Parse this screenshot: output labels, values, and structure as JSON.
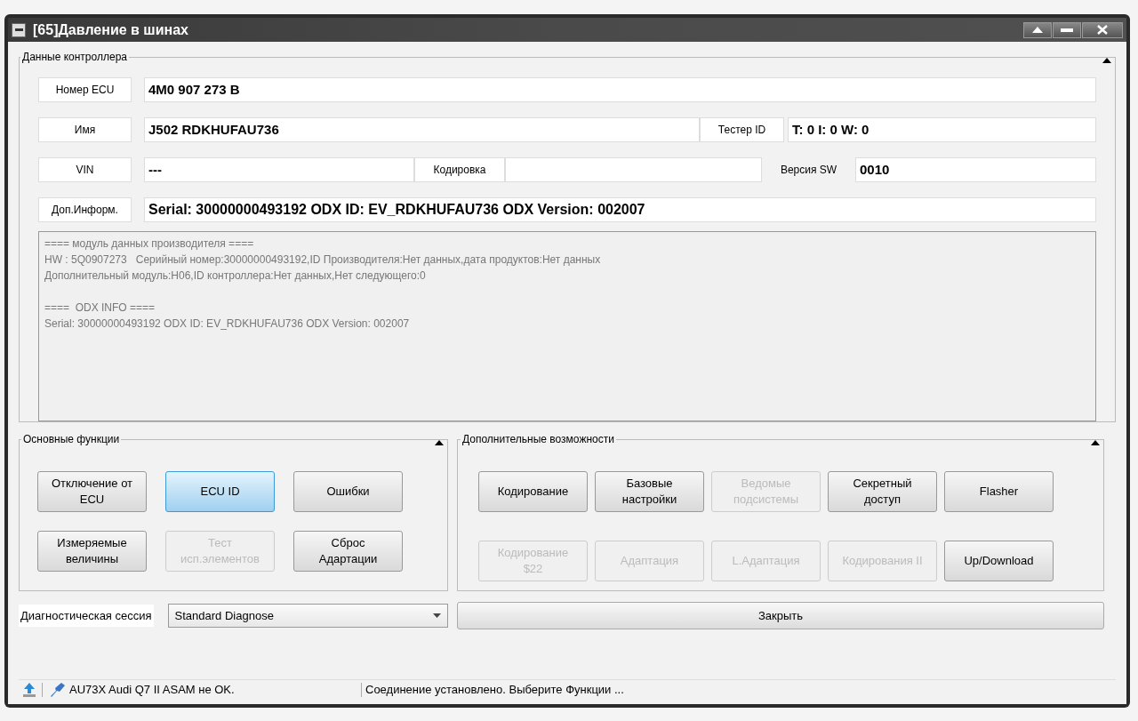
{
  "window": {
    "title": "[65]Давление в шинах"
  },
  "controller_data": {
    "title": "Данные контроллера",
    "ecu_number": {
      "label": "Номер ECU",
      "value": "4M0 907 273 B"
    },
    "name": {
      "label": "Имя",
      "value": "J502  RDKHUFAU736"
    },
    "tester_id": {
      "label": "Тестер ID",
      "value": "T: 0 I: 0 W: 0"
    },
    "vin": {
      "label": "VIN",
      "value": "---"
    },
    "coding": {
      "label": "Кодировка"
    },
    "sw_version": {
      "label": "Версия SW",
      "value": "0010"
    },
    "extra_info": {
      "label": "Доп.Информ.",
      "value": "Serial: 30000000493192 ODX ID: EV_RDKHUFAU736 ODX Version: 002007"
    },
    "details": [
      [
        "==== модуль данных производителя ====",
        "HW : 5Q0907273   Серийный номер:30000000493192,ID Производителя:Нет данных,дата продуктов:Нет данных",
        "Дополнительный модуль:H06,ID контроллера:Нет данных,Нет следующего:0"
      ],
      [
        "====  ODX INFO ====",
        "Serial: 30000000493192 ODX ID: EV_RDKHUFAU736 ODX Version: 002007"
      ]
    ]
  },
  "main_functions": {
    "title": "Основные функции",
    "buttons": [
      {
        "label": "Отключение от ECU",
        "selected": false,
        "disabled": false
      },
      {
        "label": "ECU ID",
        "selected": true,
        "disabled": false
      },
      {
        "label": "Ошибки",
        "selected": false,
        "disabled": false
      },
      {
        "label": "Измеряемые величины",
        "selected": false,
        "disabled": false
      },
      {
        "label": "Тест исп.элементов",
        "selected": false,
        "disabled": true
      },
      {
        "label": "Сброс Адартации",
        "selected": false,
        "disabled": false
      }
    ]
  },
  "extra_functions": {
    "title": "Дополнительные возможности",
    "buttons": [
      {
        "label": "Кодирование",
        "disabled": false
      },
      {
        "label": "Базовые настройки",
        "disabled": false
      },
      {
        "label": "Ведомые подсистемы",
        "disabled": true
      },
      {
        "label": "Секретный доступ",
        "disabled": false
      },
      {
        "label": "Flasher",
        "disabled": false
      },
      {
        "label": "Кодирование $22",
        "disabled": true
      },
      {
        "label": "Адаптация",
        "disabled": true
      },
      {
        "label": "L.Адаптация",
        "disabled": true
      },
      {
        "label": "Кодирования II",
        "disabled": true
      },
      {
        "label": "Up/Download",
        "disabled": false
      }
    ]
  },
  "session": {
    "label": "Диагностическая сессия",
    "value": "Standard Diagnose"
  },
  "close_button": "Закрыть",
  "status_bar": {
    "interface": "AU73X Audi Q7 II ASAM не OK.",
    "message": "Соединение установлено. Выберите Функции ..."
  }
}
